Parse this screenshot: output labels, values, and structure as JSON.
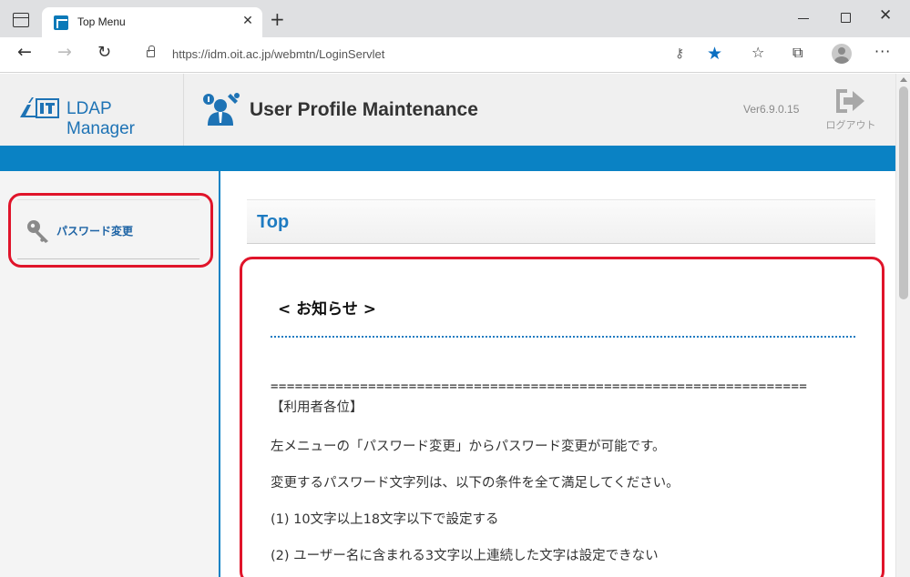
{
  "browser": {
    "tab_title": "Top Menu",
    "url": "https://idm.oit.ac.jp/webmtn/LoginServlet"
  },
  "header": {
    "brand_name": "LDAP Manager",
    "app_title": "User Profile Maintenance",
    "version": "Ver6.9.0.15",
    "logout_label": "ログアウト"
  },
  "sidebar": {
    "items": [
      {
        "label": "パスワード変更",
        "icon": "key-icon"
      }
    ]
  },
  "main": {
    "heading": "Top",
    "notice_title": "< お知らせ >",
    "separator": "==================================================================",
    "lines": [
      "【利用者各位】",
      "左メニューの「パスワード変更」からパスワード変更が可能です。",
      "変更するパスワード文字列は、以下の条件を全て満足してください。",
      "(1) 10文字以上18文字以下で設定する",
      "(2) ユーザー名に含まれる3文字以上連続した文字は設定できない"
    ]
  },
  "colors": {
    "accent_blue": "#0a82c4",
    "highlight_red": "#e0142a",
    "brand_blue": "#1e73b5"
  }
}
